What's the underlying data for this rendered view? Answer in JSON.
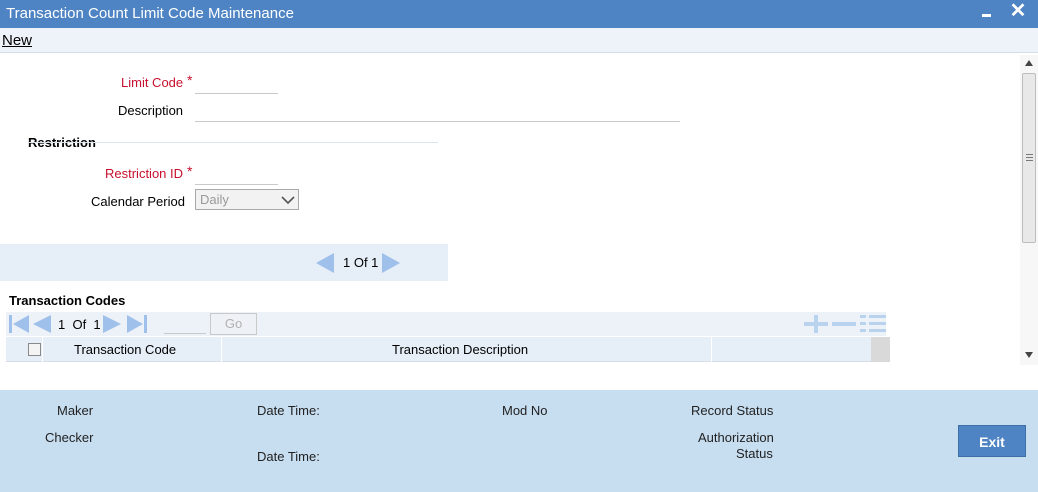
{
  "window": {
    "title": "Transaction Count Limit Code Maintenance",
    "minimize_icon": "minimize-icon",
    "close_icon": "close-icon",
    "close_glyph": "✕"
  },
  "menu": {
    "new_label": "New"
  },
  "form": {
    "limit_code_label": "Limit Code",
    "limit_code_value": "",
    "required_mark": "*",
    "description_label": "Description",
    "description_value": ""
  },
  "restriction": {
    "section_title": "Restriction",
    "restriction_id_label": "Restriction ID",
    "restriction_id_value": "",
    "calendar_period_label": "Calendar Period",
    "calendar_period_value": "Daily"
  },
  "pager": {
    "text": "1 Of 1"
  },
  "transaction_codes": {
    "section_title": "Transaction Codes",
    "page_text": "1  Of  1",
    "page_input": "",
    "go_label": "Go",
    "columns": [
      "Transaction Code",
      "Transaction Description"
    ],
    "rows": []
  },
  "footer": {
    "maker_label": "Maker",
    "checker_label": "Checker",
    "date_time_label_1": "Date Time:",
    "date_time_label_2": "Date Time:",
    "mod_no_label": "Mod No",
    "record_status_label": "Record Status",
    "auth_status_line1": "Authorization",
    "auth_status_line2": "Status",
    "exit_label": "Exit"
  },
  "colors": {
    "title_bar": "#4e84c4",
    "footer_bg": "#c7ddf0",
    "required_red": "#c8102e",
    "nav_arrow": "#9ec0ea"
  }
}
